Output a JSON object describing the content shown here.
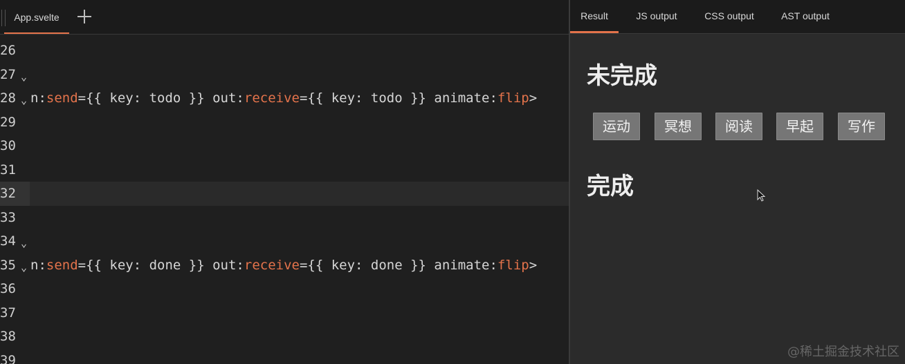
{
  "editor": {
    "file_tab": "App.svelte",
    "add_tab_icon": "plus-icon",
    "lines": [
      {
        "n": "26",
        "fold": "",
        "segments": []
      },
      {
        "n": "27",
        "fold": "⌄",
        "segments": []
      },
      {
        "n": "28",
        "fold": "⌄",
        "segments": [
          {
            "t": "n:",
            "c": "punc"
          },
          {
            "t": "send",
            "c": "attr"
          },
          {
            "t": "={{ key: todo }} out:",
            "c": "punc"
          },
          {
            "t": "receive",
            "c": "attr"
          },
          {
            "t": "={{ key: todo }} animate:",
            "c": "punc"
          },
          {
            "t": "flip",
            "c": "attr"
          },
          {
            "t": ">",
            "c": "punc"
          }
        ]
      },
      {
        "n": "29",
        "fold": "",
        "segments": []
      },
      {
        "n": "30",
        "fold": "",
        "segments": []
      },
      {
        "n": "31",
        "fold": "",
        "segments": []
      },
      {
        "n": "32",
        "fold": "",
        "segments": [],
        "active": true
      },
      {
        "n": "33",
        "fold": "",
        "segments": []
      },
      {
        "n": "34",
        "fold": "⌄",
        "segments": []
      },
      {
        "n": "35",
        "fold": "⌄",
        "segments": [
          {
            "t": "n:",
            "c": "punc"
          },
          {
            "t": "send",
            "c": "attr"
          },
          {
            "t": "={{ key: done }} out:",
            "c": "punc"
          },
          {
            "t": "receive",
            "c": "attr"
          },
          {
            "t": "={{ key: done }} animate:",
            "c": "punc"
          },
          {
            "t": "flip",
            "c": "attr"
          },
          {
            "t": ">",
            "c": "punc"
          }
        ]
      },
      {
        "n": "36",
        "fold": "",
        "segments": []
      },
      {
        "n": "37",
        "fold": "",
        "segments": []
      },
      {
        "n": "38",
        "fold": "",
        "segments": []
      },
      {
        "n": "39",
        "fold": "",
        "segments": []
      }
    ]
  },
  "output": {
    "tabs": [
      {
        "label": "Result",
        "active": true
      },
      {
        "label": "JS output",
        "active": false
      },
      {
        "label": "CSS output",
        "active": false
      },
      {
        "label": "AST output",
        "active": false
      }
    ],
    "todo_heading": "未完成",
    "todo_items": [
      "运动",
      "冥想",
      "阅读",
      "早起",
      "写作"
    ],
    "done_heading": "完成"
  },
  "watermark": "@稀土掘金技术社区",
  "colors": {
    "accent": "#e4734b",
    "editor_bg": "#1f1f1f",
    "output_bg": "#2b2b2b",
    "chip_bg": "#767676"
  }
}
